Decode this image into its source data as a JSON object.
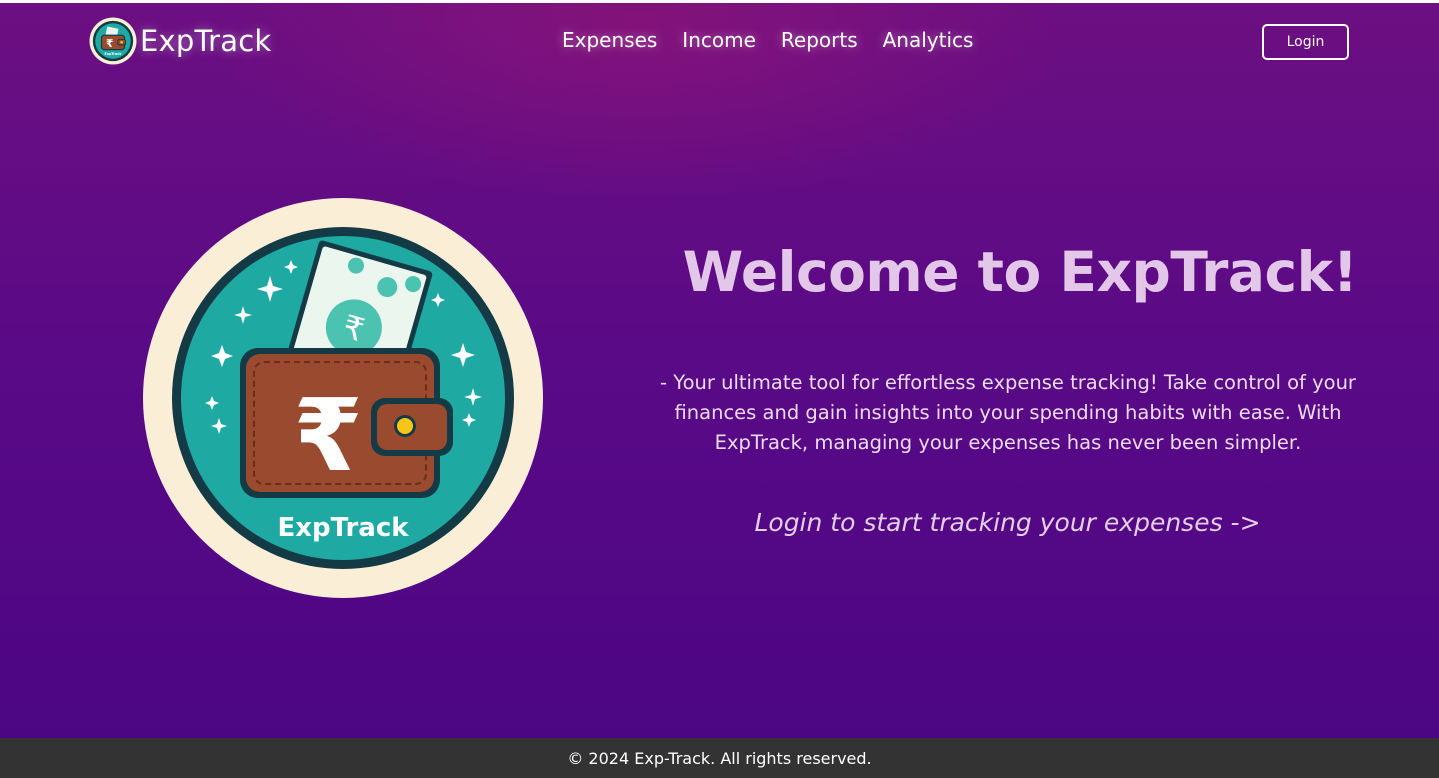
{
  "header": {
    "brand": "ExpTrack",
    "nav": [
      {
        "label": "Expenses"
      },
      {
        "label": "Income"
      },
      {
        "label": "Reports"
      },
      {
        "label": "Analytics"
      }
    ],
    "login_label": "Login"
  },
  "hero": {
    "logo_text": "ExpTrack",
    "logo_badge_text": "ExpTrack",
    "title": "Welcome to ExpTrack!",
    "description": "- Your ultimate tool for effortless expense tracking! Take control of your finances and gain insights into your spending habits with ease. With ExpTrack, managing your expenses has never been simpler.",
    "cta": "Login to start tracking your expenses ->"
  },
  "footer": {
    "text": "© 2024 Exp-Track. All rights reserved."
  },
  "icons": {
    "brand_logo": "wallet-rupee-logo-icon",
    "hero_logo": "wallet-rupee-logo-icon",
    "currency": "rupee-icon"
  },
  "colors": {
    "background_top": "#6c0f82",
    "background_bottom": "#4b0584",
    "title": "#e2c7e8",
    "footer_bg": "#333333",
    "logo_teal": "#1fa9a3",
    "logo_ring": "#143a45",
    "logo_cream": "#faefd6",
    "wallet_brown": "#9a4a2e"
  }
}
